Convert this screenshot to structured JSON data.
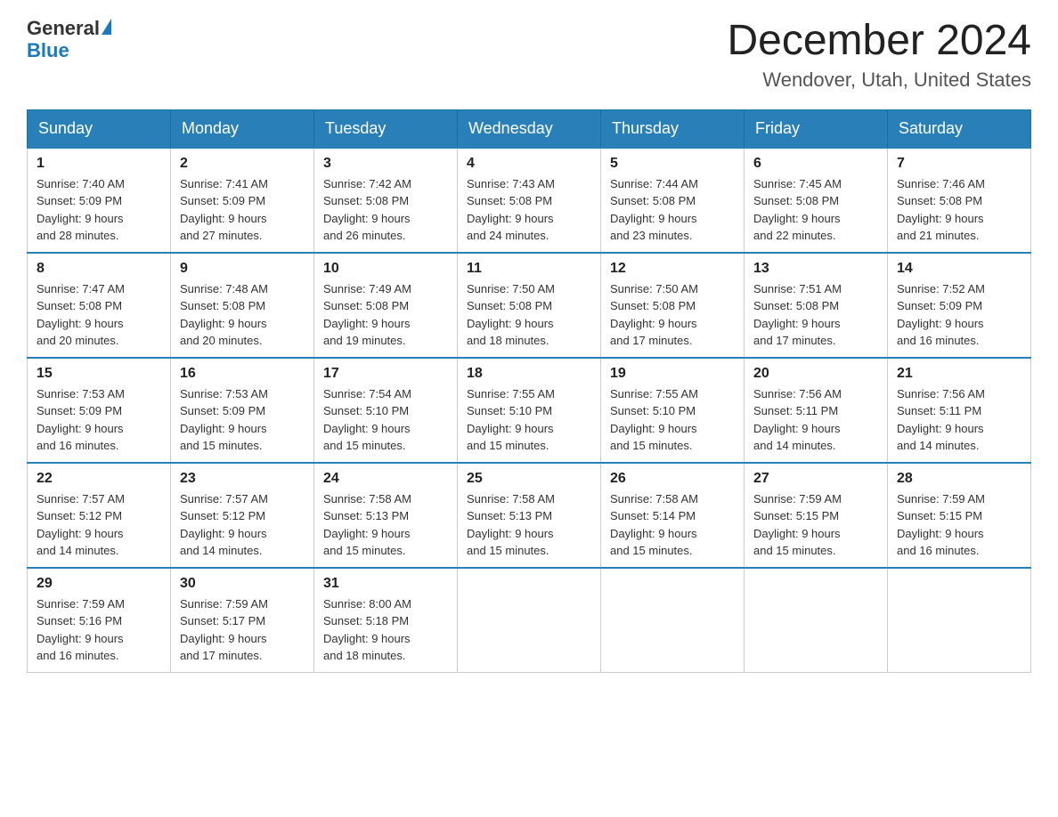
{
  "logo": {
    "text1": "General",
    "text2": "Blue"
  },
  "title": {
    "month_year": "December 2024",
    "location": "Wendover, Utah, United States"
  },
  "days_of_week": [
    "Sunday",
    "Monday",
    "Tuesday",
    "Wednesday",
    "Thursday",
    "Friday",
    "Saturday"
  ],
  "weeks": [
    [
      {
        "day": "1",
        "sunrise": "7:40 AM",
        "sunset": "5:09 PM",
        "daylight": "9 hours and 28 minutes."
      },
      {
        "day": "2",
        "sunrise": "7:41 AM",
        "sunset": "5:09 PM",
        "daylight": "9 hours and 27 minutes."
      },
      {
        "day": "3",
        "sunrise": "7:42 AM",
        "sunset": "5:08 PM",
        "daylight": "9 hours and 26 minutes."
      },
      {
        "day": "4",
        "sunrise": "7:43 AM",
        "sunset": "5:08 PM",
        "daylight": "9 hours and 24 minutes."
      },
      {
        "day": "5",
        "sunrise": "7:44 AM",
        "sunset": "5:08 PM",
        "daylight": "9 hours and 23 minutes."
      },
      {
        "day": "6",
        "sunrise": "7:45 AM",
        "sunset": "5:08 PM",
        "daylight": "9 hours and 22 minutes."
      },
      {
        "day": "7",
        "sunrise": "7:46 AM",
        "sunset": "5:08 PM",
        "daylight": "9 hours and 21 minutes."
      }
    ],
    [
      {
        "day": "8",
        "sunrise": "7:47 AM",
        "sunset": "5:08 PM",
        "daylight": "9 hours and 20 minutes."
      },
      {
        "day": "9",
        "sunrise": "7:48 AM",
        "sunset": "5:08 PM",
        "daylight": "9 hours and 20 minutes."
      },
      {
        "day": "10",
        "sunrise": "7:49 AM",
        "sunset": "5:08 PM",
        "daylight": "9 hours and 19 minutes."
      },
      {
        "day": "11",
        "sunrise": "7:50 AM",
        "sunset": "5:08 PM",
        "daylight": "9 hours and 18 minutes."
      },
      {
        "day": "12",
        "sunrise": "7:50 AM",
        "sunset": "5:08 PM",
        "daylight": "9 hours and 17 minutes."
      },
      {
        "day": "13",
        "sunrise": "7:51 AM",
        "sunset": "5:08 PM",
        "daylight": "9 hours and 17 minutes."
      },
      {
        "day": "14",
        "sunrise": "7:52 AM",
        "sunset": "5:09 PM",
        "daylight": "9 hours and 16 minutes."
      }
    ],
    [
      {
        "day": "15",
        "sunrise": "7:53 AM",
        "sunset": "5:09 PM",
        "daylight": "9 hours and 16 minutes."
      },
      {
        "day": "16",
        "sunrise": "7:53 AM",
        "sunset": "5:09 PM",
        "daylight": "9 hours and 15 minutes."
      },
      {
        "day": "17",
        "sunrise": "7:54 AM",
        "sunset": "5:10 PM",
        "daylight": "9 hours and 15 minutes."
      },
      {
        "day": "18",
        "sunrise": "7:55 AM",
        "sunset": "5:10 PM",
        "daylight": "9 hours and 15 minutes."
      },
      {
        "day": "19",
        "sunrise": "7:55 AM",
        "sunset": "5:10 PM",
        "daylight": "9 hours and 15 minutes."
      },
      {
        "day": "20",
        "sunrise": "7:56 AM",
        "sunset": "5:11 PM",
        "daylight": "9 hours and 14 minutes."
      },
      {
        "day": "21",
        "sunrise": "7:56 AM",
        "sunset": "5:11 PM",
        "daylight": "9 hours and 14 minutes."
      }
    ],
    [
      {
        "day": "22",
        "sunrise": "7:57 AM",
        "sunset": "5:12 PM",
        "daylight": "9 hours and 14 minutes."
      },
      {
        "day": "23",
        "sunrise": "7:57 AM",
        "sunset": "5:12 PM",
        "daylight": "9 hours and 14 minutes."
      },
      {
        "day": "24",
        "sunrise": "7:58 AM",
        "sunset": "5:13 PM",
        "daylight": "9 hours and 15 minutes."
      },
      {
        "day": "25",
        "sunrise": "7:58 AM",
        "sunset": "5:13 PM",
        "daylight": "9 hours and 15 minutes."
      },
      {
        "day": "26",
        "sunrise": "7:58 AM",
        "sunset": "5:14 PM",
        "daylight": "9 hours and 15 minutes."
      },
      {
        "day": "27",
        "sunrise": "7:59 AM",
        "sunset": "5:15 PM",
        "daylight": "9 hours and 15 minutes."
      },
      {
        "day": "28",
        "sunrise": "7:59 AM",
        "sunset": "5:15 PM",
        "daylight": "9 hours and 16 minutes."
      }
    ],
    [
      {
        "day": "29",
        "sunrise": "7:59 AM",
        "sunset": "5:16 PM",
        "daylight": "9 hours and 16 minutes."
      },
      {
        "day": "30",
        "sunrise": "7:59 AM",
        "sunset": "5:17 PM",
        "daylight": "9 hours and 17 minutes."
      },
      {
        "day": "31",
        "sunrise": "8:00 AM",
        "sunset": "5:18 PM",
        "daylight": "9 hours and 18 minutes."
      },
      null,
      null,
      null,
      null
    ]
  ],
  "labels": {
    "sunrise": "Sunrise:",
    "sunset": "Sunset:",
    "daylight": "Daylight:"
  }
}
